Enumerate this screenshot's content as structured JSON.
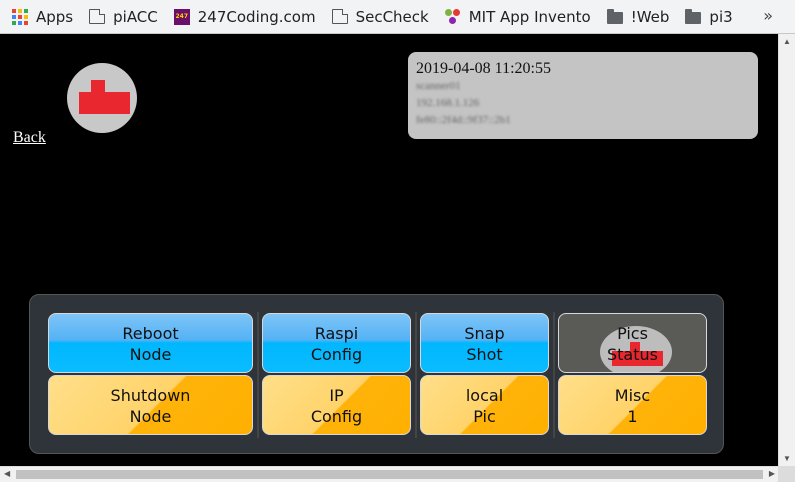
{
  "bookmarks": {
    "items": [
      {
        "label": "Apps",
        "icon": "apps-grid-icon"
      },
      {
        "label": "piACC",
        "icon": "document-icon"
      },
      {
        "label": "247Coding.com",
        "icon": "247coding-icon"
      },
      {
        "label": "SecCheck",
        "icon": "document-icon"
      },
      {
        "label": "MIT App Invento",
        "icon": "mit-app-inventor-icon"
      },
      {
        "label": "!Web",
        "icon": "folder-icon"
      },
      {
        "label": "pi3",
        "icon": "folder-icon"
      }
    ],
    "overflow": "»",
    "coding_icon_text": "247"
  },
  "page": {
    "back_link": "Back",
    "info": {
      "datetime": "2019-04-08 11:20:55",
      "blurred_lines": [
        "scanner01",
        "192.168.1.126",
        "fe80::2f4d::9f37::2b1"
      ]
    }
  },
  "buttons": [
    {
      "line1": "Reboot",
      "line2": "Node",
      "style": "blue"
    },
    {
      "line1": "Raspi",
      "line2": "Config",
      "style": "blue"
    },
    {
      "line1": "Snap",
      "line2": "Shot",
      "style": "blue"
    },
    {
      "line1": "Pics",
      "line2": "Status",
      "style": "gray"
    },
    {
      "line1": "Shutdown",
      "line2": "Node",
      "style": "orange"
    },
    {
      "line1": "IP",
      "line2": "Config",
      "style": "orange"
    },
    {
      "line1": "local",
      "line2": "Pic",
      "style": "orange"
    },
    {
      "line1": "Misc",
      "line2": "1",
      "style": "orange"
    }
  ],
  "colors": {
    "logo_red": "#e8282e",
    "logo_circle": "#c8c8c8",
    "button_blue": "#00b7ff",
    "button_orange": "#ffb000",
    "panel_bg": "#2f343a"
  }
}
